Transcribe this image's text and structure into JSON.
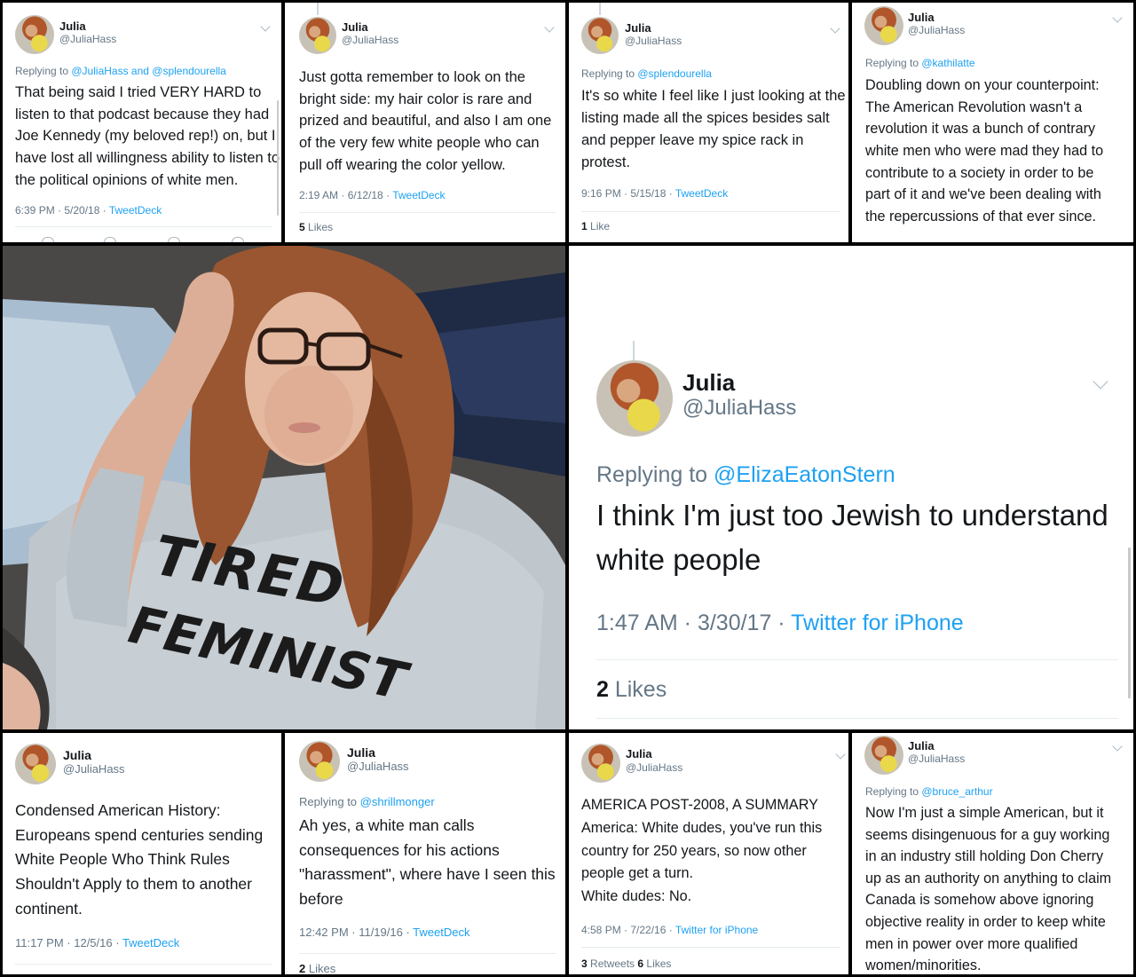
{
  "author": {
    "name": "Julia",
    "handle": "@JuliaHass"
  },
  "tweets": {
    "t1": {
      "replying_prefix": "Replying to ",
      "replying_to": "@JuliaHass and @splendourella",
      "lines": [
        "That being said I tried VERY HARD to",
        "listen to that podcast because they had",
        "Joe Kennedy (my beloved rep!) on, but I",
        "have lost all willingness ability to listen to",
        "the political opinions of white men."
      ],
      "time": "6:39 PM · 5/20/18 · ",
      "source": "TweetDeck"
    },
    "t2": {
      "lines": [
        "Just gotta remember to look on the",
        "bright side: my hair color is rare and",
        "prized and beautiful, and also I am one",
        "of the very few white people who can",
        "pull off wearing the color yellow."
      ],
      "time": "2:19 AM · 6/12/18 · ",
      "source": "TweetDeck",
      "likes_count": "5",
      "likes_label": " Likes"
    },
    "t3": {
      "replying_prefix": "Replying to ",
      "replying_to": "@splendourella",
      "lines": [
        "It's so white I feel like I just looking at the",
        "listing made all the spices besides salt",
        "and pepper leave my spice rack in",
        "protest."
      ],
      "time": "9:16 PM · 5/15/18 · ",
      "source": "TweetDeck",
      "likes_count": "1",
      "likes_label": " Like"
    },
    "t4": {
      "replying_prefix": "Replying to ",
      "replying_to": "@kathilatte",
      "lines": [
        "Doubling down on your counterpoint:",
        "The American Revolution wasn't a",
        "revolution it was a bunch of contrary",
        "white men who were mad they had to",
        "contribute to a society in order to be",
        "part of it and we've been dealing with",
        "the repercussions of that ever since."
      ]
    },
    "main": {
      "replying_prefix": "Replying to ",
      "replying_to": "@ElizaEatonStern",
      "lines": [
        "I think I'm just too Jewish to understand",
        "white people"
      ],
      "time": "1:47 AM · 3/30/17 · ",
      "source": "Twitter for iPhone",
      "likes_count": "2",
      "likes_label": " Likes"
    },
    "t5": {
      "lines": [
        "Condensed American History:",
        "Europeans spend centuries sending",
        "White People Who Think Rules",
        "Shouldn't Apply to them to another",
        "continent."
      ],
      "time": "11:17 PM · 12/5/16 · ",
      "source": "TweetDeck"
    },
    "t6": {
      "replying_prefix": "Replying to ",
      "replying_to": "@shrillmonger",
      "lines": [
        "Ah yes, a white man calls",
        "consequences for his actions",
        "\"harassment\", where have I seen this",
        "before"
      ],
      "time": "12:42 PM · 11/19/16 · ",
      "source": "TweetDeck",
      "likes_count": "2",
      "likes_label": " Likes"
    },
    "t7": {
      "lines": [
        "AMERICA POST-2008, A SUMMARY",
        "America: White dudes, you've run this",
        "country for 250 years, so now other",
        "people get a turn.",
        "White dudes: No."
      ],
      "time": "4:58 PM · 7/22/16 · ",
      "source": "Twitter for iPhone",
      "retweets_count": "3",
      "retweets_label": " Retweets ",
      "likes_count": "6",
      "likes_label": " Likes"
    },
    "t8": {
      "replying_prefix": "Replying to ",
      "replying_to": "@bruce_arthur",
      "lines": [
        "Now I'm just a simple American, but it",
        "seems disingenuous for a guy working",
        "in an industry still holding Don Cherry",
        "up as an authority on anything to claim",
        "Canada is somehow above ignoring",
        "objective reality in order to keep white",
        "men in power over more qualified",
        "women/minorities."
      ]
    }
  },
  "photo": {
    "shirt_line1": "TIRED",
    "shirt_line2": "FEMINIST"
  },
  "colors": {
    "link": "#1da1f2",
    "muted": "#657786",
    "text": "#14171a",
    "border": "#000000"
  }
}
